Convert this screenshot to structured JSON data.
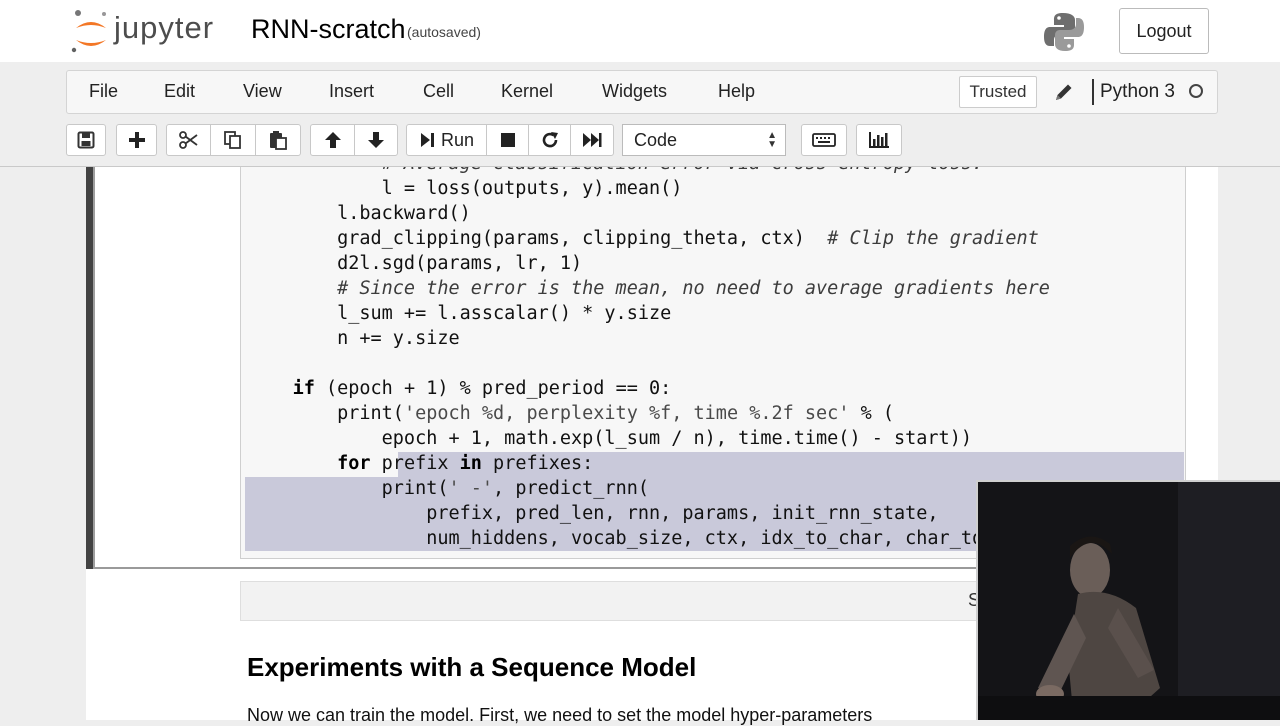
{
  "header": {
    "logo_text": "jupyter",
    "notebook_name": "RNN-scratch",
    "autosave_status": "(autosaved)",
    "logout_label": "Logout"
  },
  "menubar": {
    "items": [
      "File",
      "Edit",
      "View",
      "Insert",
      "Cell",
      "Kernel",
      "Widgets",
      "Help"
    ],
    "trusted_label": "Trusted",
    "kernel_name": "Python 3"
  },
  "toolbar": {
    "run_label": "Run",
    "cell_type": "Code",
    "icons": [
      "save-icon",
      "plus-icon",
      "cut-icon",
      "copy-icon",
      "paste-icon",
      "arrow-up-icon",
      "arrow-down-icon",
      "run-icon",
      "stop-icon",
      "restart-icon",
      "fast-forward-icon",
      "keyboard-icon",
      "chart-icon"
    ]
  },
  "code_cell": {
    "lines": [
      "            # Average classification error via cross entropy loss.",
      "            l = loss(outputs, y).mean()",
      "        l.backward()",
      "        grad_clipping(params, clipping_theta, ctx)  # Clip the gradient",
      "        d2l.sgd(params, lr, 1)",
      "        # Since the error is the mean, no need to average gradients here",
      "        l_sum += l.asscalar() * y.size",
      "        n += y.size",
      "",
      "    if (epoch + 1) % pred_period == 0:",
      "        print('epoch %d, perplexity %f, time %.2f sec' % (",
      "            epoch + 1, math.exp(l_sum / n), time.time() - start))",
      "        for prefix in prefixes:",
      "            print(' -', predict_rnn(",
      "                prefix, pred_len, rnn, params, init_rnn_state,",
      "                num_hiddens, vocab_size, ctx, idx_to_char, char_to_idx))"
    ]
  },
  "markdown_cell": {
    "prompt_letter": "S",
    "heading": "Experiments with a Sequence Model",
    "text": "Now we can train the model. First, we need to set the model hyper-parameters"
  }
}
